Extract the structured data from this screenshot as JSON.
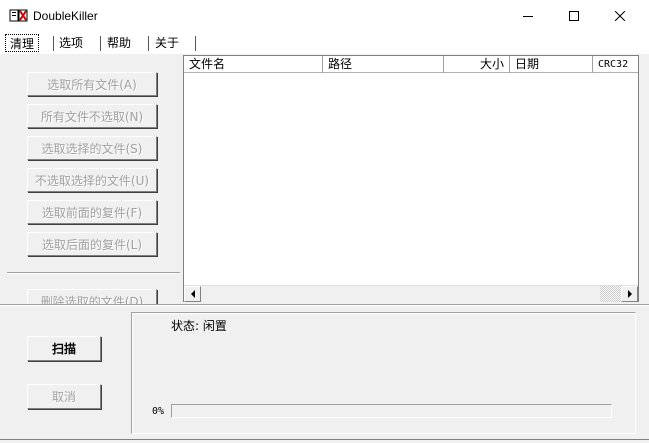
{
  "window": {
    "title": "DoubleKiller",
    "icon": "app-icon",
    "controls": [
      "minimize-icon",
      "maximize-icon",
      "close-icon"
    ]
  },
  "tabs": [
    {
      "label": "清理",
      "active": true
    },
    {
      "label": "选项",
      "active": false
    },
    {
      "label": "帮助",
      "active": false
    },
    {
      "label": "关于",
      "active": false
    }
  ],
  "actions": {
    "select_all": "选取所有文件(A)",
    "select_none": "所有文件不选取(N)",
    "select_chosen": "选取选择的文件(S)",
    "unselect_chosen": "不选取选择的文件(U)",
    "select_previous_dupes": "选取前面的复件(F)",
    "select_later_dupes": "选取后面的复件(L)",
    "delete_selected": "删除选取的文件(D)"
  },
  "list": {
    "columns": [
      "文件名",
      "路径",
      "大小",
      "日期",
      "CRC32"
    ],
    "rows": []
  },
  "controls": {
    "scan": "扫描",
    "cancel": "取消"
  },
  "status": {
    "text": "状态: 闲置",
    "progress_label": "0%",
    "progress": 0
  },
  "colors": {
    "window_bg": "#f0f0f0",
    "list_bg": "#ffffff",
    "disabled_text": "#a0a0a0",
    "progress_fill": "#3b8dde"
  }
}
